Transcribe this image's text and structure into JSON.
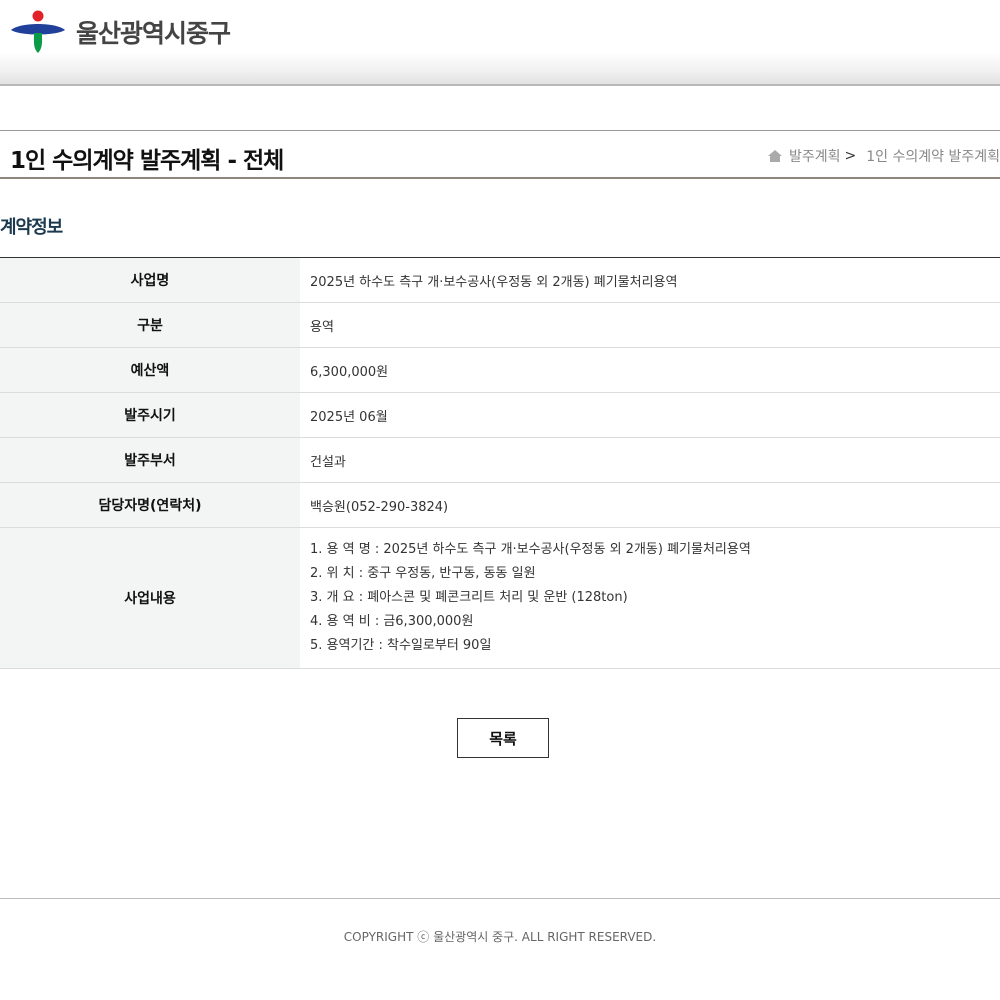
{
  "header": {
    "logo_text": "울산광역시중구",
    "logo_colors": {
      "red": "#e2222a",
      "blue": "#21409a",
      "green": "#0a9a48"
    }
  },
  "titlebar": {
    "title": "1인 수의계약 발주계획 - 전체",
    "breadcrumb": [
      "발주계획",
      "1인 수의계약 발주계획"
    ],
    "breadcrumb_sep": ">"
  },
  "section": {
    "title": "계약정보"
  },
  "contract": {
    "rows": [
      {
        "label": "사업명",
        "value": "2025년 하수도 측구 개·보수공사(우정동 외 2개동) 폐기물처리용역"
      },
      {
        "label": "구분",
        "value": "용역"
      },
      {
        "label": "예산액",
        "value": "6,300,000원"
      },
      {
        "label": "발주시기",
        "value": "2025년 06월"
      },
      {
        "label": "발주부서",
        "value": "건설과"
      },
      {
        "label": "담당자명(연락처)",
        "value": "백승원(052-290-3824)"
      }
    ],
    "content_label": "사업내용",
    "content_lines": [
      "1. 용 역 명 : 2025년 하수도 측구 개·보수공사(우정동 외 2개동) 폐기물처리용역",
      "2. 위 치 : 중구 우정동, 반구동, 동동 일원",
      "3. 개 요 : 폐아스콘 및 폐콘크리트 처리 및 운반 (128ton)",
      "4. 용 역 비 : 금6,300,000원",
      "5. 용역기간 : 착수일로부터 90일"
    ]
  },
  "actions": {
    "list_label": "목록"
  },
  "footer": {
    "copyright": "COPYRIGHT ⓒ 울산광역시 중구. ALL RIGHT RESERVED."
  }
}
